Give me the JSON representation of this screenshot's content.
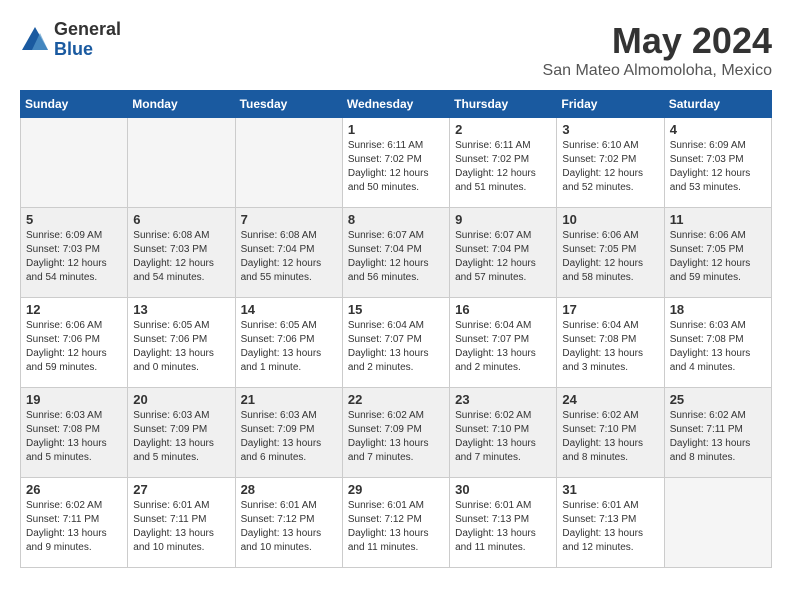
{
  "logo": {
    "general": "General",
    "blue": "Blue"
  },
  "title": "May 2024",
  "location": "San Mateo Almomoloha, Mexico",
  "days_of_week": [
    "Sunday",
    "Monday",
    "Tuesday",
    "Wednesday",
    "Thursday",
    "Friday",
    "Saturday"
  ],
  "weeks": [
    [
      {
        "num": "",
        "info": "",
        "empty": true
      },
      {
        "num": "",
        "info": "",
        "empty": true
      },
      {
        "num": "",
        "info": "",
        "empty": true
      },
      {
        "num": "1",
        "info": "Sunrise: 6:11 AM\nSunset: 7:02 PM\nDaylight: 12 hours\nand 50 minutes."
      },
      {
        "num": "2",
        "info": "Sunrise: 6:11 AM\nSunset: 7:02 PM\nDaylight: 12 hours\nand 51 minutes."
      },
      {
        "num": "3",
        "info": "Sunrise: 6:10 AM\nSunset: 7:02 PM\nDaylight: 12 hours\nand 52 minutes."
      },
      {
        "num": "4",
        "info": "Sunrise: 6:09 AM\nSunset: 7:03 PM\nDaylight: 12 hours\nand 53 minutes."
      }
    ],
    [
      {
        "num": "5",
        "info": "Sunrise: 6:09 AM\nSunset: 7:03 PM\nDaylight: 12 hours\nand 54 minutes.",
        "gray": true
      },
      {
        "num": "6",
        "info": "Sunrise: 6:08 AM\nSunset: 7:03 PM\nDaylight: 12 hours\nand 54 minutes.",
        "gray": true
      },
      {
        "num": "7",
        "info": "Sunrise: 6:08 AM\nSunset: 7:04 PM\nDaylight: 12 hours\nand 55 minutes.",
        "gray": true
      },
      {
        "num": "8",
        "info": "Sunrise: 6:07 AM\nSunset: 7:04 PM\nDaylight: 12 hours\nand 56 minutes.",
        "gray": true
      },
      {
        "num": "9",
        "info": "Sunrise: 6:07 AM\nSunset: 7:04 PM\nDaylight: 12 hours\nand 57 minutes.",
        "gray": true
      },
      {
        "num": "10",
        "info": "Sunrise: 6:06 AM\nSunset: 7:05 PM\nDaylight: 12 hours\nand 58 minutes.",
        "gray": true
      },
      {
        "num": "11",
        "info": "Sunrise: 6:06 AM\nSunset: 7:05 PM\nDaylight: 12 hours\nand 59 minutes.",
        "gray": true
      }
    ],
    [
      {
        "num": "12",
        "info": "Sunrise: 6:06 AM\nSunset: 7:06 PM\nDaylight: 12 hours\nand 59 minutes."
      },
      {
        "num": "13",
        "info": "Sunrise: 6:05 AM\nSunset: 7:06 PM\nDaylight: 13 hours\nand 0 minutes."
      },
      {
        "num": "14",
        "info": "Sunrise: 6:05 AM\nSunset: 7:06 PM\nDaylight: 13 hours\nand 1 minute."
      },
      {
        "num": "15",
        "info": "Sunrise: 6:04 AM\nSunset: 7:07 PM\nDaylight: 13 hours\nand 2 minutes."
      },
      {
        "num": "16",
        "info": "Sunrise: 6:04 AM\nSunset: 7:07 PM\nDaylight: 13 hours\nand 2 minutes."
      },
      {
        "num": "17",
        "info": "Sunrise: 6:04 AM\nSunset: 7:08 PM\nDaylight: 13 hours\nand 3 minutes."
      },
      {
        "num": "18",
        "info": "Sunrise: 6:03 AM\nSunset: 7:08 PM\nDaylight: 13 hours\nand 4 minutes."
      }
    ],
    [
      {
        "num": "19",
        "info": "Sunrise: 6:03 AM\nSunset: 7:08 PM\nDaylight: 13 hours\nand 5 minutes.",
        "gray": true
      },
      {
        "num": "20",
        "info": "Sunrise: 6:03 AM\nSunset: 7:09 PM\nDaylight: 13 hours\nand 5 minutes.",
        "gray": true
      },
      {
        "num": "21",
        "info": "Sunrise: 6:03 AM\nSunset: 7:09 PM\nDaylight: 13 hours\nand 6 minutes.",
        "gray": true
      },
      {
        "num": "22",
        "info": "Sunrise: 6:02 AM\nSunset: 7:09 PM\nDaylight: 13 hours\nand 7 minutes.",
        "gray": true
      },
      {
        "num": "23",
        "info": "Sunrise: 6:02 AM\nSunset: 7:10 PM\nDaylight: 13 hours\nand 7 minutes.",
        "gray": true
      },
      {
        "num": "24",
        "info": "Sunrise: 6:02 AM\nSunset: 7:10 PM\nDaylight: 13 hours\nand 8 minutes.",
        "gray": true
      },
      {
        "num": "25",
        "info": "Sunrise: 6:02 AM\nSunset: 7:11 PM\nDaylight: 13 hours\nand 8 minutes.",
        "gray": true
      }
    ],
    [
      {
        "num": "26",
        "info": "Sunrise: 6:02 AM\nSunset: 7:11 PM\nDaylight: 13 hours\nand 9 minutes."
      },
      {
        "num": "27",
        "info": "Sunrise: 6:01 AM\nSunset: 7:11 PM\nDaylight: 13 hours\nand 10 minutes."
      },
      {
        "num": "28",
        "info": "Sunrise: 6:01 AM\nSunset: 7:12 PM\nDaylight: 13 hours\nand 10 minutes."
      },
      {
        "num": "29",
        "info": "Sunrise: 6:01 AM\nSunset: 7:12 PM\nDaylight: 13 hours\nand 11 minutes."
      },
      {
        "num": "30",
        "info": "Sunrise: 6:01 AM\nSunset: 7:13 PM\nDaylight: 13 hours\nand 11 minutes."
      },
      {
        "num": "31",
        "info": "Sunrise: 6:01 AM\nSunset: 7:13 PM\nDaylight: 13 hours\nand 12 minutes."
      },
      {
        "num": "",
        "info": "",
        "empty": true
      }
    ]
  ]
}
